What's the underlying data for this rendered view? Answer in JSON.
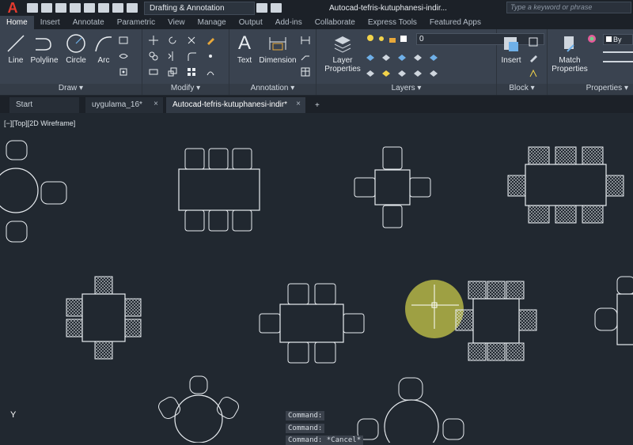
{
  "titlebar": {
    "app_logo": "A",
    "workspace": "Drafting & Annotation",
    "document_title": "Autocad-tefris-kutuphanesi-indir...",
    "search_placeholder": "Type a keyword or phrase"
  },
  "ribbon_tabs": [
    "Home",
    "Insert",
    "Annotate",
    "Parametric",
    "View",
    "Manage",
    "Output",
    "Add-ins",
    "Collaborate",
    "Express Tools",
    "Featured Apps"
  ],
  "draw_panel": {
    "title": "Draw",
    "line": "Line",
    "polyline": "Polyline",
    "circle": "Circle",
    "arc": "Arc"
  },
  "modify_panel": {
    "title": "Modify"
  },
  "annotation_panel": {
    "title": "Annotation",
    "text": "Text",
    "dimension": "Dimension"
  },
  "layers_panel": {
    "title": "Layers",
    "layer_properties_line1": "Layer",
    "layer_properties_line2": "Properties",
    "current_layer": "0"
  },
  "block_panel": {
    "title": "Block",
    "insert": "Insert"
  },
  "properties_panel": {
    "title": "Properties",
    "match_line1": "Match",
    "match_line2": "Properties",
    "bylayer": "By"
  },
  "file_tabs": {
    "start": "Start",
    "doc1": "uygulama_16*",
    "current": "Autocad-tefris-kutuphanesi-indir*",
    "close": "×",
    "new": "+"
  },
  "viewport_label": "[−][Top][2D Wireframe]",
  "command_lines": [
    "Command:",
    "Command:",
    "Command: *Cancel*"
  ],
  "axis_y": "Y",
  "colors": {
    "canvas": "#212830",
    "ribbon": "#3a4350",
    "cursor_highlight": "#c8c84a",
    "logo": "#e63b2e"
  }
}
